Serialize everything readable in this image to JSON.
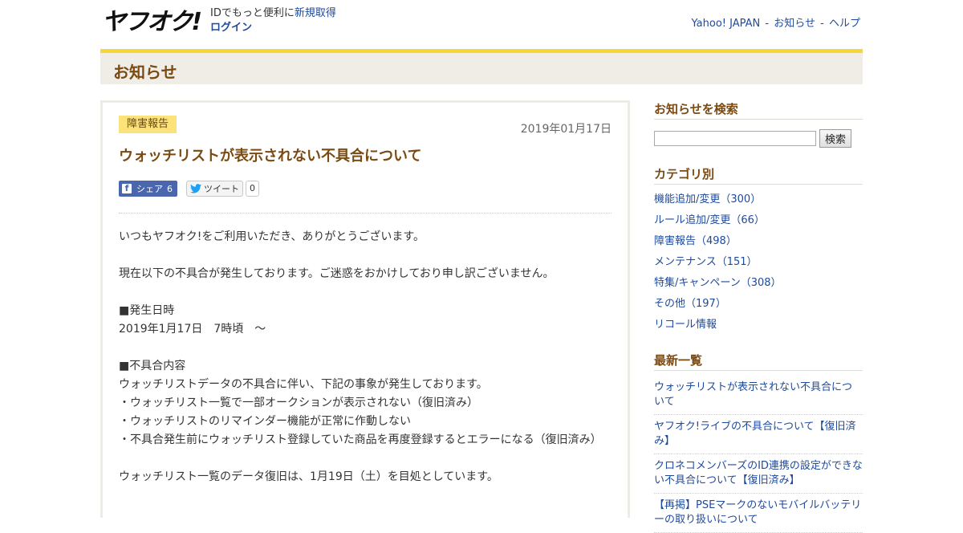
{
  "header": {
    "logo_text": "ヤフオク!",
    "id_prompt": "IDでもっと便利に",
    "signup_link": "新規取得",
    "login_link": "ログイン",
    "nav": {
      "yahoo_japan": "Yahoo! JAPAN",
      "sep1": "-",
      "news": "お知らせ",
      "sep2": "-",
      "help": "ヘルプ"
    }
  },
  "page_title": "お知らせ",
  "article": {
    "category_badge": "障害報告",
    "date": "2019年01月17日",
    "title": "ウォッチリストが表示されない不具合について",
    "share": {
      "fb_label": "シェア",
      "fb_count": "6",
      "tweet_label": "ツイート",
      "tweet_count": "0"
    },
    "lines": [
      "いつもヤフオク!をご利用いただき、ありがとうございます。",
      "",
      "現在以下の不具合が発生しております。ご迷惑をおかけしており申し訳ございません。",
      "",
      "■発生日時",
      "2019年1月17日　7時頃　～",
      "",
      "■不具合内容",
      "ウォッチリストデータの不具合に伴い、下記の事象が発生しております。",
      "・ウォッチリスト一覧で一部オークションが表示されない（復旧済み）",
      "・ウォッチリストのリマインダー機能が正常に作動しない",
      "・不具合発生前にウォッチリスト登録していた商品を再度登録するとエラーになる（復旧済み）",
      "",
      "ウォッチリスト一覧のデータ復旧は、1月19日（土）を目処としています。"
    ]
  },
  "sidebar": {
    "search_heading": "お知らせを検索",
    "search_value": "",
    "search_button": "検索",
    "category_heading": "カテゴリ別",
    "categories": [
      "機能追加/変更（300）",
      "ルール追加/変更（66）",
      "障害報告（498）",
      "メンテナンス（151）",
      "特集/キャンペーン（308）",
      "その他（197）",
      "リコール情報"
    ],
    "latest_heading": "最新一覧",
    "latest": [
      "ウォッチリストが表示されない不具合について",
      "ヤフオク!ライブの不具合について【復旧済み】",
      "クロネコメンバーズのID連携の設定ができない不具合について【復旧済み】",
      "【再掲】PSEマークのないモバイルバッテリーの取り扱いについて"
    ]
  },
  "colors": {
    "accent_yellow": "#f5d73a",
    "title_brown": "#7a4a12",
    "link_blue": "#1e4a9c",
    "badge_yellow": "#fbe27a"
  }
}
